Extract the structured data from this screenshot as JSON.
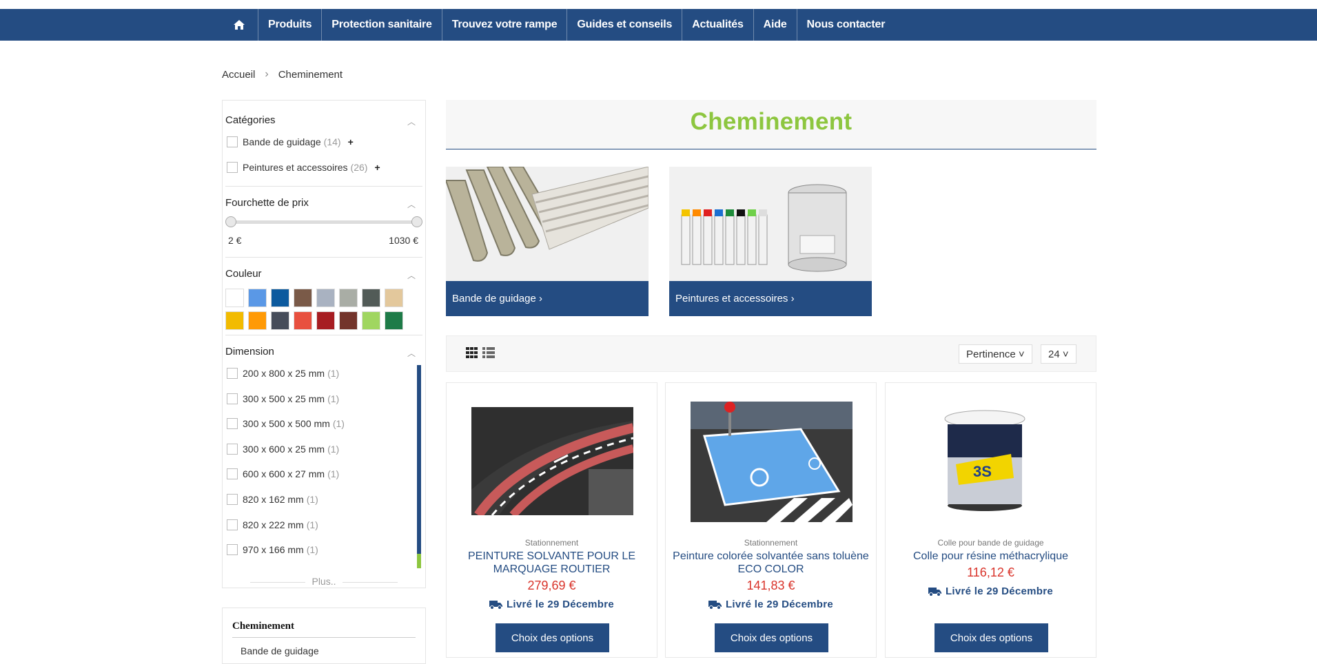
{
  "nav": {
    "home_icon": "home-icon",
    "items": [
      "Produits",
      "Protection sanitaire",
      "Trouvez votre rampe",
      "Guides et conseils",
      "Actualités",
      "Aide",
      "Nous contacter"
    ]
  },
  "breadcrumb": {
    "home": "Accueil",
    "current": "Cheminement"
  },
  "filters": {
    "categories": {
      "title": "Catégories",
      "items": [
        {
          "label": "Bande de guidage",
          "count": "(14)",
          "expand": "+"
        },
        {
          "label": "Peintures et accessoires",
          "count": "(26)",
          "expand": "+"
        }
      ]
    },
    "price": {
      "title": "Fourchette de prix",
      "min": "2 €",
      "max": "1030 €"
    },
    "color": {
      "title": "Couleur",
      "swatches": [
        "#ffffff",
        "#5a98e6",
        "#0c5a9e",
        "#7a5a48",
        "#a9b2c1",
        "#a9ada5",
        "#525b57",
        "#e3c89c",
        "#f2bb00",
        "#ff9a06",
        "#464d5a",
        "#e8503f",
        "#a71d22",
        "#73342b",
        "#a0d660",
        "#1e7b48"
      ]
    },
    "dimension": {
      "title": "Dimension",
      "items": [
        {
          "label": "200 x 800 x 25 mm",
          "count": "(1)"
        },
        {
          "label": "300 x 500 x 25 mm",
          "count": "(1)"
        },
        {
          "label": "300 x 500 x 500 mm",
          "count": "(1)"
        },
        {
          "label": "300 x 600 x 25 mm",
          "count": "(1)"
        },
        {
          "label": "600 x 600 x 27 mm",
          "count": "(1)"
        },
        {
          "label": "820 x 162 mm",
          "count": "(1)"
        },
        {
          "label": "820 x 222 mm",
          "count": "(1)"
        },
        {
          "label": "970 x 166 mm",
          "count": "(1)"
        }
      ],
      "more": "Plus.."
    }
  },
  "side_block": {
    "title": "Cheminement",
    "sub": "Bande de guidage"
  },
  "hero": {
    "title": "Cheminement"
  },
  "subcategories": [
    {
      "label": "Bande de guidage ›"
    },
    {
      "label": "Peintures et accessoires ›"
    }
  ],
  "toolbar": {
    "sort": "Pertinence ˅",
    "per_page": "24 ˅"
  },
  "products": [
    {
      "category": "Stationnement",
      "title": "PEINTURE SOLVANTE POUR LE MARQUAGE ROUTIER",
      "price": "279,69 €",
      "delivery": "Livré le 29 Décembre",
      "button": "Choix des options"
    },
    {
      "category": "Stationnement",
      "title": "Peinture colorée solvantée sans toluène ECO COLOR",
      "price": "141,83 €",
      "delivery": "Livré le 29 Décembre",
      "button": "Choix des options"
    },
    {
      "category": "Colle pour bande de guidage",
      "title": "Colle pour résine méthacrylique",
      "price": "116,12 €",
      "delivery": "Livré le 29 Décembre",
      "button": "Choix des options"
    }
  ],
  "colors": {
    "primary": "#244c82",
    "accent": "#8dc63f",
    "price": "#d9332a"
  }
}
